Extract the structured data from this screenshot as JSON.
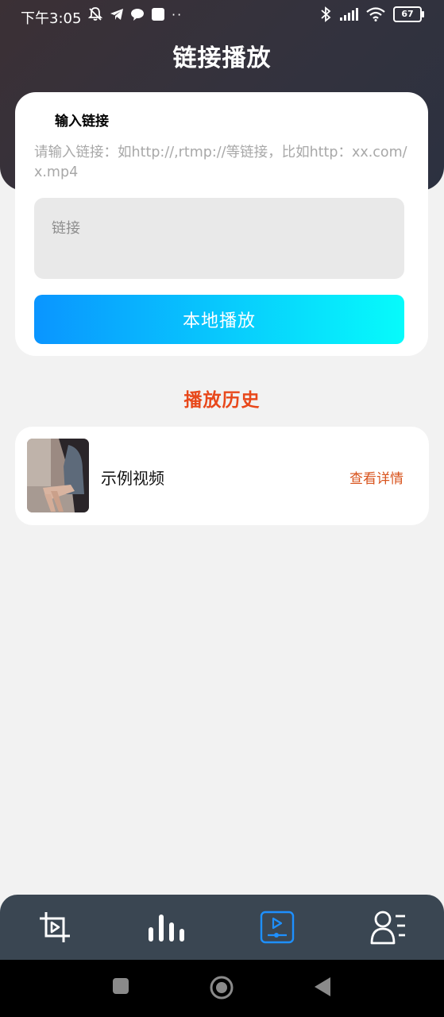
{
  "status_bar": {
    "time": "下午3:05",
    "battery": "67",
    "icons_left": [
      "mute-bell-icon",
      "telegram-icon",
      "chat-bubble-icon",
      "square-app-icon",
      "more-dots-icon"
    ],
    "icons_right": [
      "bluetooth-icon",
      "signal-icon",
      "wifi-icon",
      "battery-icon"
    ]
  },
  "header": {
    "title": "链接播放"
  },
  "input_card": {
    "label": "输入链接",
    "hint": "请输入链接：如http://,rtmp://等链接，比如http：xx.com/x.mp4",
    "input_placeholder": "链接",
    "input_value": "",
    "play_button": "本地播放"
  },
  "history": {
    "title": "播放历史",
    "items": [
      {
        "name": "示例视频",
        "detail_link": "查看详情",
        "thumbnail": "person-sitting-photo"
      }
    ]
  },
  "bottom_nav": {
    "items": [
      {
        "icon": "crop-video-icon",
        "active": false
      },
      {
        "icon": "audio-bars-icon",
        "active": false
      },
      {
        "icon": "video-player-icon",
        "active": true
      },
      {
        "icon": "profile-list-icon",
        "active": false
      }
    ],
    "active_color": "#1e90ff",
    "inactive_color": "#ffffff"
  },
  "system_nav": [
    "recents-square-icon",
    "home-circle-icon",
    "back-triangle-icon"
  ],
  "colors": {
    "accent_orange": "#e8481b",
    "button_gradient_start": "#0a95ff",
    "button_gradient_end": "#06fbfb",
    "header_dark": "#34323d"
  }
}
